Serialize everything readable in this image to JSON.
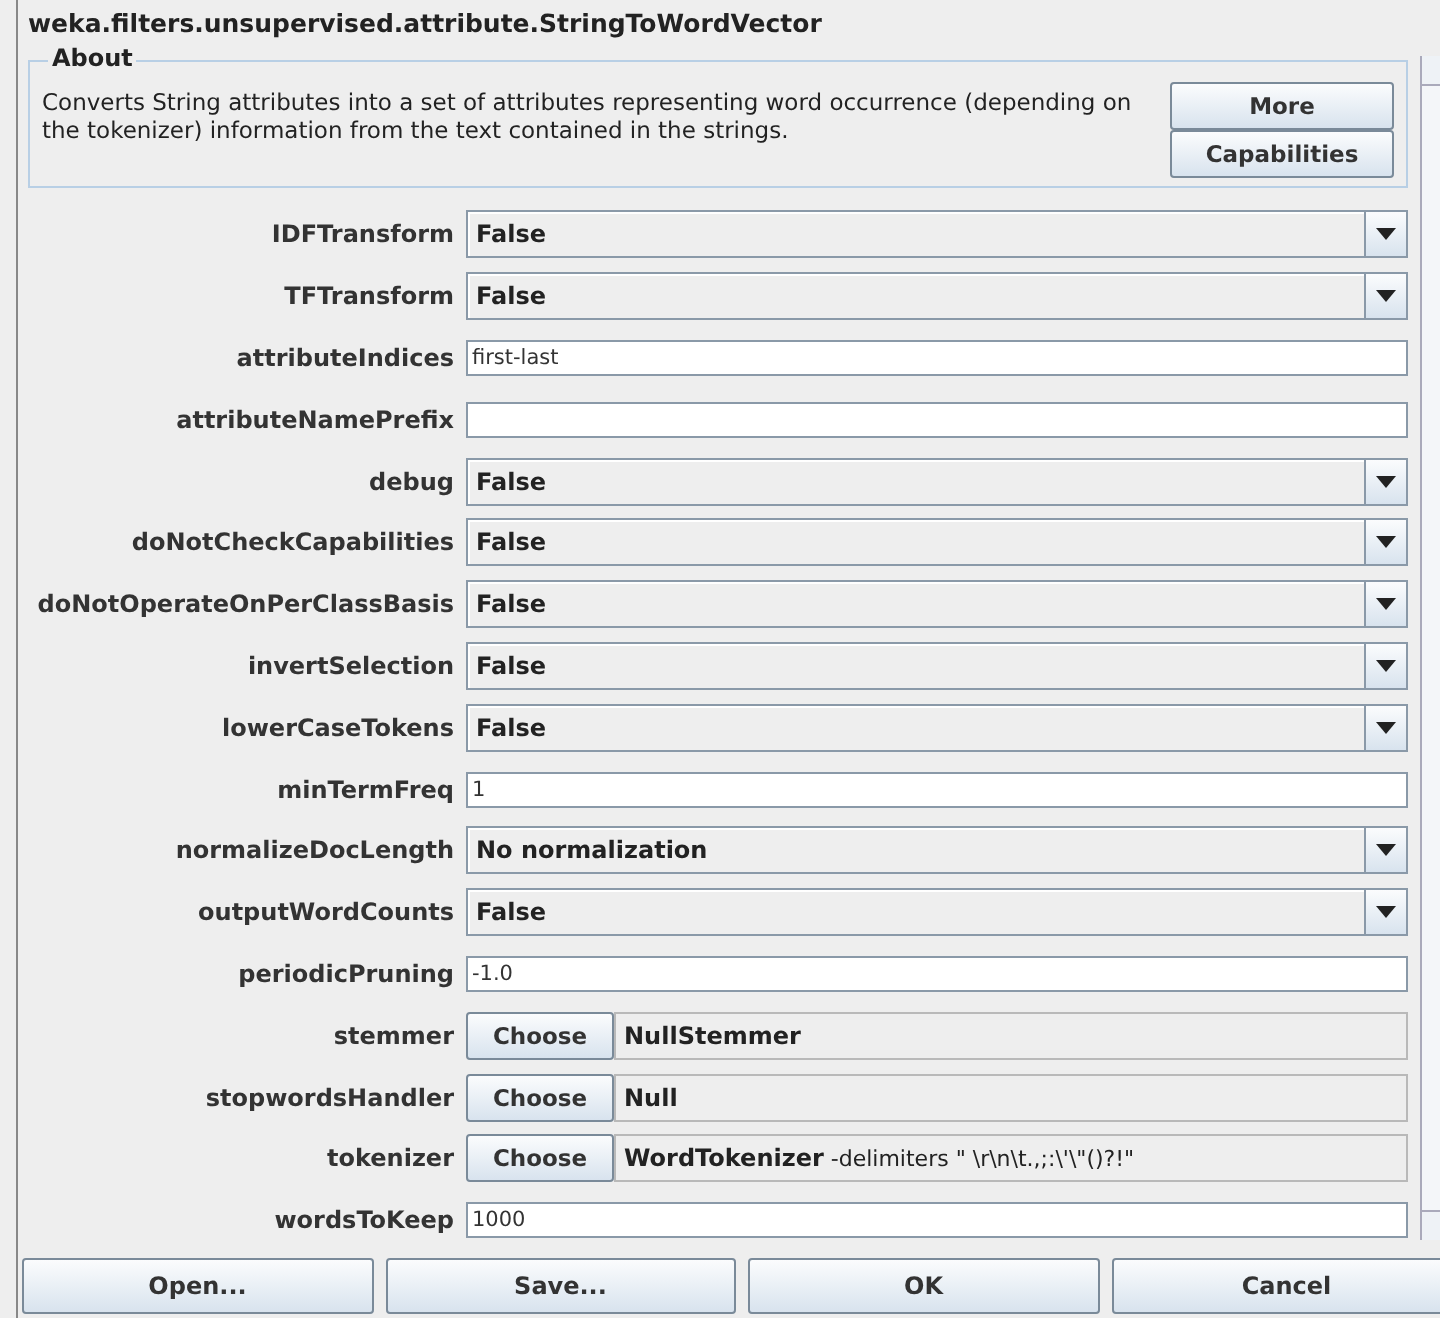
{
  "window": {
    "title": "weka.filters.unsupervised.attribute.StringToWordVector"
  },
  "about": {
    "legend": "About",
    "text": "Converts String attributes into a set of attributes representing word occurrence (depending on the tokenizer) information from the text contained in the strings.",
    "buttons": [
      "More",
      "Capabilities"
    ]
  },
  "properties": [
    {
      "label": "IDFTransform",
      "kind": "choice",
      "value": "False"
    },
    {
      "label": "TFTransform",
      "kind": "choice",
      "value": "False"
    },
    {
      "label": "attributeIndices",
      "kind": "text",
      "value": "first-last"
    },
    {
      "label": "attributeNamePrefix",
      "kind": "text"
    },
    {
      "label": "debug",
      "kind": "choice",
      "value": "False"
    },
    {
      "label": "doNotCheckCapabilities",
      "kind": "choice",
      "value": "False"
    },
    {
      "label": "doNotOperateOnPerClassBasis",
      "kind": "choice",
      "value": "False"
    },
    {
      "label": "invertSelection",
      "kind": "choice",
      "value": "False"
    },
    {
      "label": "lowerCaseTokens",
      "kind": "choice",
      "value": "False"
    },
    {
      "label": "minTermFreq",
      "kind": "text",
      "value": "1"
    },
    {
      "label": "normalizeDocLength",
      "kind": "choice",
      "value": "No normalization"
    },
    {
      "label": "outputWordCounts",
      "kind": "choice",
      "value": "False"
    },
    {
      "label": "periodicPruning",
      "kind": "text",
      "value": "-1.0"
    },
    {
      "label": "stemmer",
      "kind": "object",
      "button": "Choose",
      "name": "NullStemmer"
    },
    {
      "label": "stopwordsHandler",
      "kind": "object",
      "button": "Choose",
      "name": "Null"
    },
    {
      "label": "tokenizer",
      "kind": "object",
      "button": "Choose",
      "name": "WordTokenizer",
      "options": "-delimiters \" \\r\\n\\t.,;:\\'\\\"()?!\""
    },
    {
      "label": "wordsToKeep",
      "kind": "text",
      "value": "1000"
    }
  ],
  "buttons": [
    "Open...",
    "Save...",
    "OK",
    "Cancel"
  ]
}
